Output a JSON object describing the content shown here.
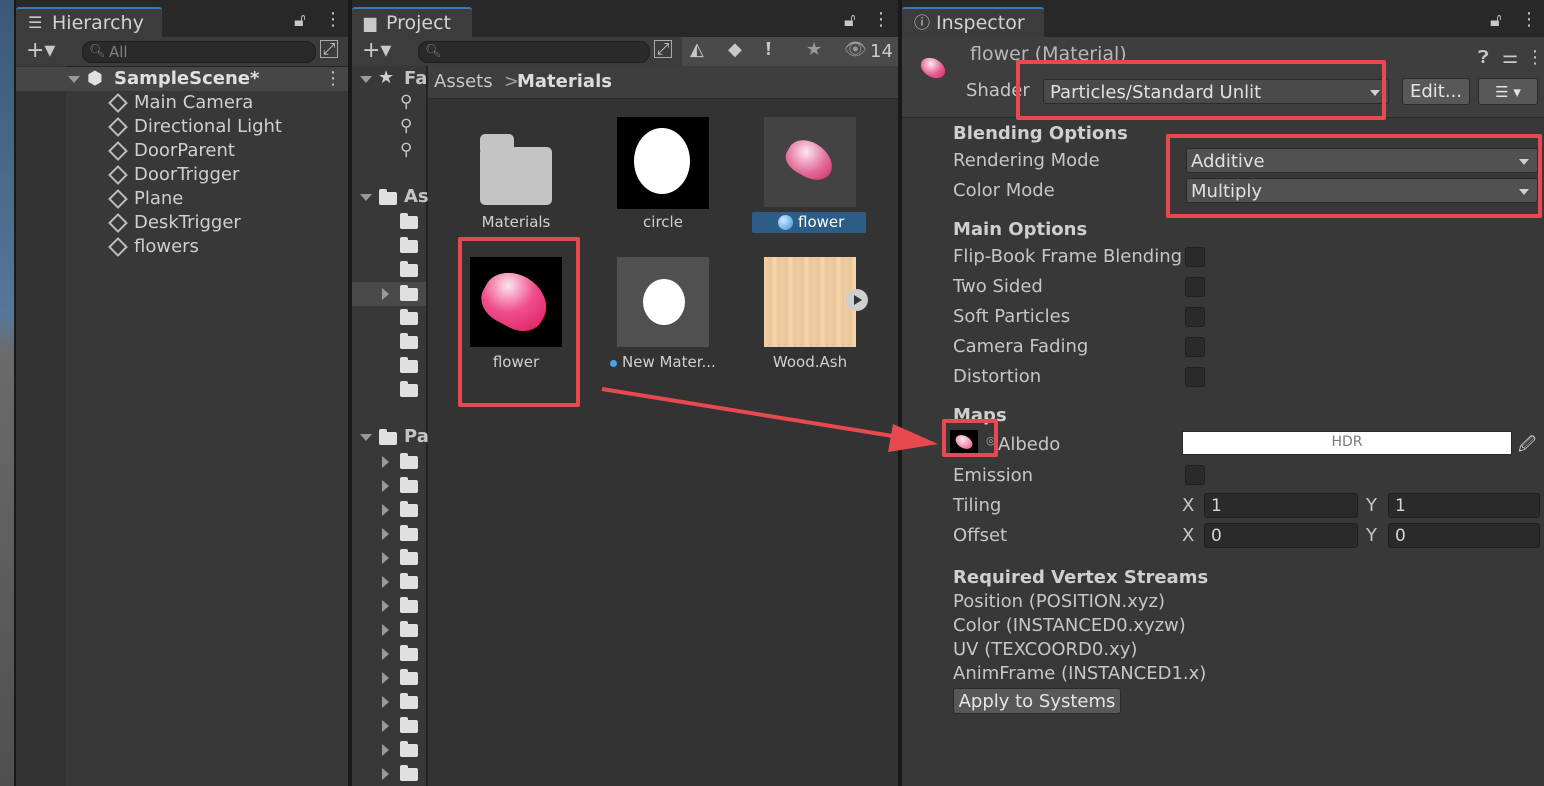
{
  "hierarchy": {
    "tab_label": "Hierarchy",
    "search_placeholder": "All",
    "scene_name": "SampleScene*",
    "items": [
      "Main Camera",
      "Directional Light",
      "DoorParent",
      "DoorTrigger",
      "Plane",
      "DeskTrigger",
      "flowers"
    ]
  },
  "project": {
    "tab_label": "Project",
    "visible_count": "14",
    "favorites_label": "Fa",
    "assets_label": "As",
    "packages_label": "Pa",
    "breadcrumb": {
      "root": "Assets",
      "separator": ">",
      "current": "Materials"
    },
    "assets": [
      {
        "label": "Materials",
        "kind": "folder"
      },
      {
        "label": "circle",
        "kind": "texture"
      },
      {
        "label": "flower",
        "kind": "material",
        "selected": true
      },
      {
        "label": "flower",
        "kind": "texture"
      },
      {
        "label": "New Mater...",
        "kind": "material"
      },
      {
        "label": "Wood.Ash",
        "kind": "texture"
      }
    ]
  },
  "inspector": {
    "tab_label": "Inspector",
    "title": "flower (Material)",
    "shader_label": "Shader",
    "shader_value": "Particles/Standard Unlit",
    "edit_button": "Edit...",
    "blending": {
      "header": "Blending Options",
      "rendering_mode_label": "Rendering Mode",
      "rendering_mode_value": "Additive",
      "color_mode_label": "Color Mode",
      "color_mode_value": "Multiply"
    },
    "main_options": {
      "header": "Main Options",
      "items": [
        "Flip-Book Frame Blending",
        "Two Sided",
        "Soft Particles",
        "Camera Fading",
        "Distortion"
      ]
    },
    "maps": {
      "header": "Maps",
      "albedo_label": "Albedo",
      "hdr_label": "HDR",
      "emission_label": "Emission",
      "tiling_label": "Tiling",
      "offset_label": "Offset",
      "x_label": "X",
      "y_label": "Y",
      "tiling_x": "1",
      "tiling_y": "1",
      "offset_x": "0",
      "offset_y": "0"
    },
    "vertex_streams": {
      "header": "Required Vertex Streams",
      "items": [
        "Position (POSITION.xyz)",
        "Color (INSTANCED0.xyzw)",
        "UV (TEXCOORD0.xy)",
        "AnimFrame (INSTANCED1.x)"
      ]
    },
    "apply_button": "Apply to Systems"
  },
  "colors": {
    "highlight": "#e8494f",
    "selection": "#2c5d87",
    "panel_bg": "#383838"
  }
}
